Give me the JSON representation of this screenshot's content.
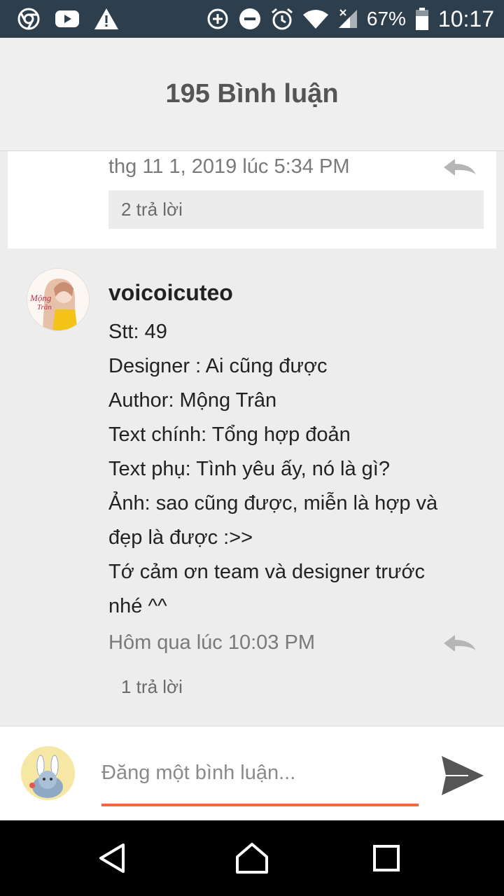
{
  "status_bar": {
    "battery": "67%",
    "time": "10:17"
  },
  "header": {
    "title": "195 Bình luận"
  },
  "previous_comment": {
    "timestamp": "thg 11 1, 2019 lúc 5:34 PM",
    "replies_label": "2 trả lời"
  },
  "comment": {
    "author": "voicoicuteo",
    "avatar_text": [
      "Mộng",
      "Trân"
    ],
    "lines": [
      "Stt: 49",
      "Designer : Ai cũng được",
      "Author: Mộng Trân",
      "Text chính: Tổng hợp đoản",
      "Text phụ: Tình yêu ấy, nó là gì?",
      "Ảnh: sao cũng được, miễn là hợp và",
      "đẹp là được :>>",
      "Tớ cảm ơn team và designer trước",
      "nhé ^^"
    ],
    "timestamp": "Hôm qua lúc 10:03 PM",
    "replies_label": "1 trả lời"
  },
  "composer": {
    "placeholder": "Đăng một bình luận...",
    "accent_color": "#ee6a3a"
  },
  "icons": {
    "status_left": [
      "chrome-icon",
      "youtube-icon",
      "warning-icon"
    ],
    "status_right": [
      "data-saver-icon",
      "do-not-disturb-icon",
      "alarm-icon",
      "wifi-icon",
      "signal-icon",
      "battery-icon"
    ],
    "nav": [
      "back-icon",
      "home-icon",
      "recents-icon"
    ]
  }
}
